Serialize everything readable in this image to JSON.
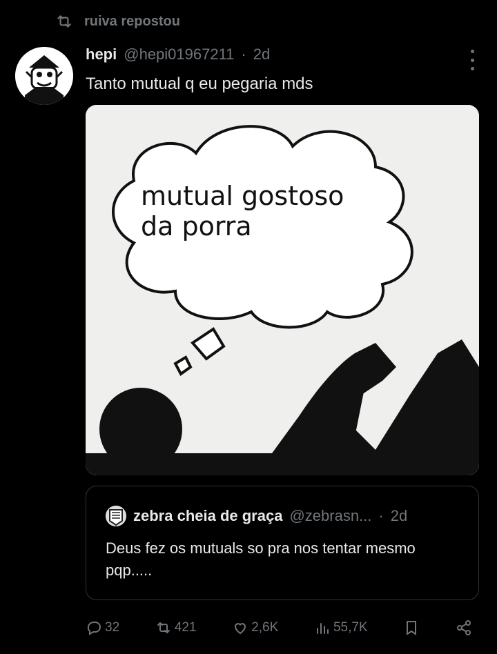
{
  "repost": {
    "text": "ruiva repostou",
    "icon": "repost-icon"
  },
  "tweet": {
    "author_name": "hepi",
    "handle": "@hepi01967211",
    "separator": "·",
    "time": "2d",
    "text": "Tanto mutual q eu pegaria mds",
    "image_text_line1": "mutual gostoso",
    "image_text_line2": "da porra"
  },
  "quote": {
    "author_name": "zebra cheia de graça",
    "handle": "@zebrasn...",
    "separator": "·",
    "time": "2d",
    "text": "Deus fez os mutuals so pra nos tentar mesmo pqp....."
  },
  "actions": {
    "replies": "32",
    "reposts": "421",
    "likes": "2,6K",
    "views": "55,7K"
  },
  "colors": {
    "background": "#000000",
    "text": "#e7e9ea",
    "muted": "#71767b",
    "border": "#2f3336"
  }
}
